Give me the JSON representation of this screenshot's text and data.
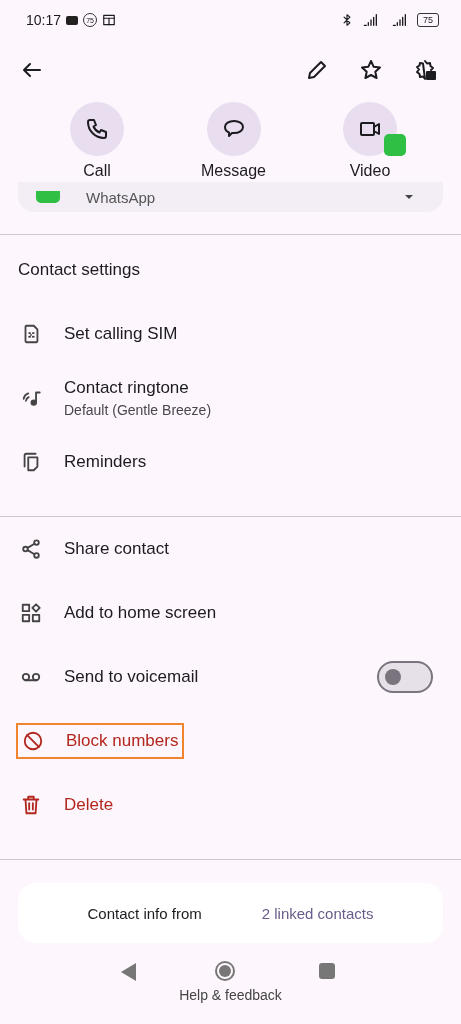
{
  "status_bar": {
    "time": "10:17",
    "notification_badge": "75",
    "battery": "75"
  },
  "actions": [
    {
      "label": "Call",
      "kind": "call"
    },
    {
      "label": "Message",
      "kind": "message"
    },
    {
      "label": "Video",
      "kind": "video"
    }
  ],
  "app_row": {
    "label": "WhatsApp"
  },
  "sections": [
    {
      "title": "Contact settings",
      "items": [
        {
          "kind": "sim",
          "label": "Set calling SIM"
        },
        {
          "kind": "ringtone",
          "label": "Contact ringtone",
          "sublabel": "Default (Gentle Breeze)"
        },
        {
          "kind": "reminders",
          "label": "Reminders"
        }
      ]
    },
    {
      "items": [
        {
          "kind": "share",
          "label": "Share contact"
        },
        {
          "kind": "home",
          "label": "Add to home screen"
        },
        {
          "kind": "voicemail",
          "label": "Send to voicemail",
          "on": false
        },
        {
          "kind": "block",
          "label": "Block numbers",
          "danger": true,
          "highlighted": true
        },
        {
          "kind": "delete",
          "label": "Delete",
          "danger": true
        }
      ]
    }
  ],
  "linked_info": {
    "text": "Contact info from",
    "link": "2 linked contacts"
  },
  "footer_link": "Help & feedback"
}
